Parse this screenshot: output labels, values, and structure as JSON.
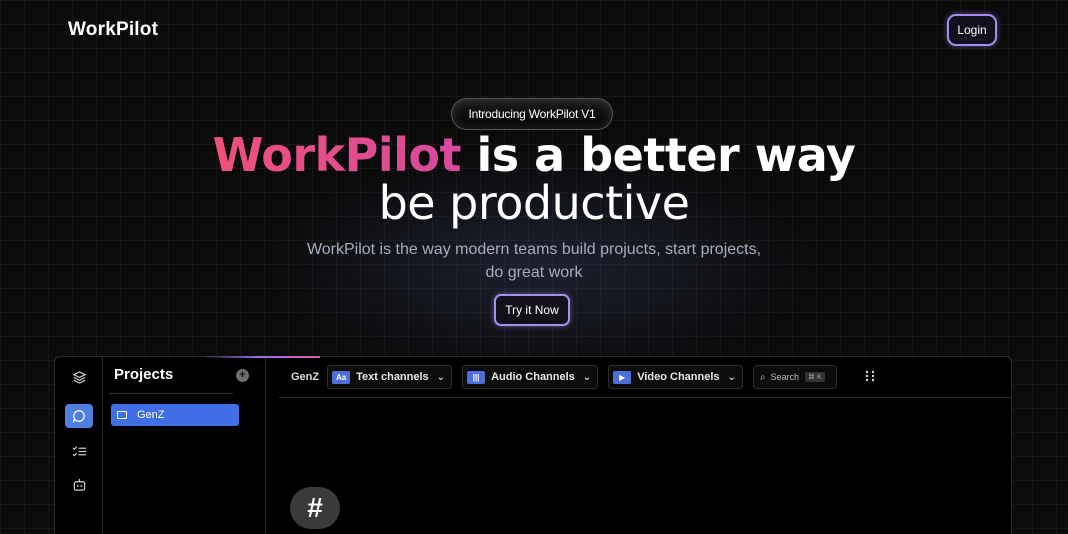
{
  "header": {
    "logo": "WorkPilot",
    "login_label": "Login"
  },
  "hero": {
    "badge": "Introducing WorkPilot V1",
    "title_brand": "WorkPilot",
    "title_rest": " is a better way",
    "title_line2": "be productive",
    "subtitle": "WorkPilot is the way modern teams build projucts, start projects, do great work",
    "cta_label": "Try it Now"
  },
  "app": {
    "sidebar_title": "Projects",
    "projects": [
      "GenZ"
    ],
    "breadcrumb": "GenZ",
    "channels": [
      {
        "label": "Text channels",
        "icon": "text-icon",
        "glyph": "Aa"
      },
      {
        "label": "Audio Channels",
        "icon": "audio-icon",
        "glyph": "|||"
      },
      {
        "label": "Video Channels",
        "icon": "video-icon",
        "glyph": "▶"
      }
    ],
    "search_placeholder": "Search",
    "search_shortcut": "⌘ K",
    "fab_glyph": "#"
  },
  "colors": {
    "accent": "#a58ef0",
    "brand_start": "#f0507a",
    "brand_end": "#d64a9e",
    "active": "#3f6ee6"
  }
}
